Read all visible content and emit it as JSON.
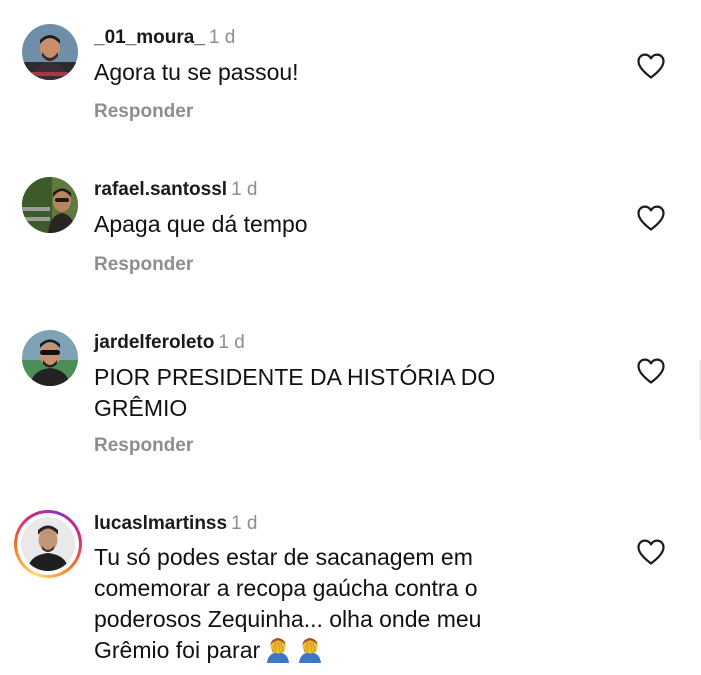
{
  "comments": [
    {
      "username": "_01_moura_",
      "time": "1 d",
      "text": "Agora tu se passou!",
      "reply_label": "Responder",
      "avatar_icon": "person-avatar-icon"
    },
    {
      "username": "rafael.santossl",
      "time": "1 d",
      "text": "Apaga que dá tempo",
      "reply_label": "Responder",
      "avatar_icon": "person-avatar-icon"
    },
    {
      "username": "jardelferoleto",
      "time": "1 d",
      "text": "PIOR PRESIDENTE DA HISTÓRIA DO GRÊMIO",
      "reply_label": "Responder",
      "avatar_icon": "person-avatar-icon"
    },
    {
      "username": "lucaslmartinss",
      "time": "1 d",
      "text": "Tu só podes estar de sacanagem em comemorar a recopa gaúcha contra o poderosos Zequinha... olha onde meu Grêmio foi parar",
      "reply_label": "",
      "avatar_icon": "person-avatar-icon",
      "has_story_ring": true,
      "trailing_emoji": [
        "person-facepalm-emoji",
        "person-facepalm-emoji"
      ]
    }
  ],
  "colors": {
    "username": "#1a1a1a",
    "secondary": "#8e8e8e",
    "text": "#111111",
    "story_ring": [
      "#feda75",
      "#fa7e1e",
      "#d62976",
      "#962fbf"
    ]
  },
  "icons": {
    "like": "heart-outline-icon"
  }
}
